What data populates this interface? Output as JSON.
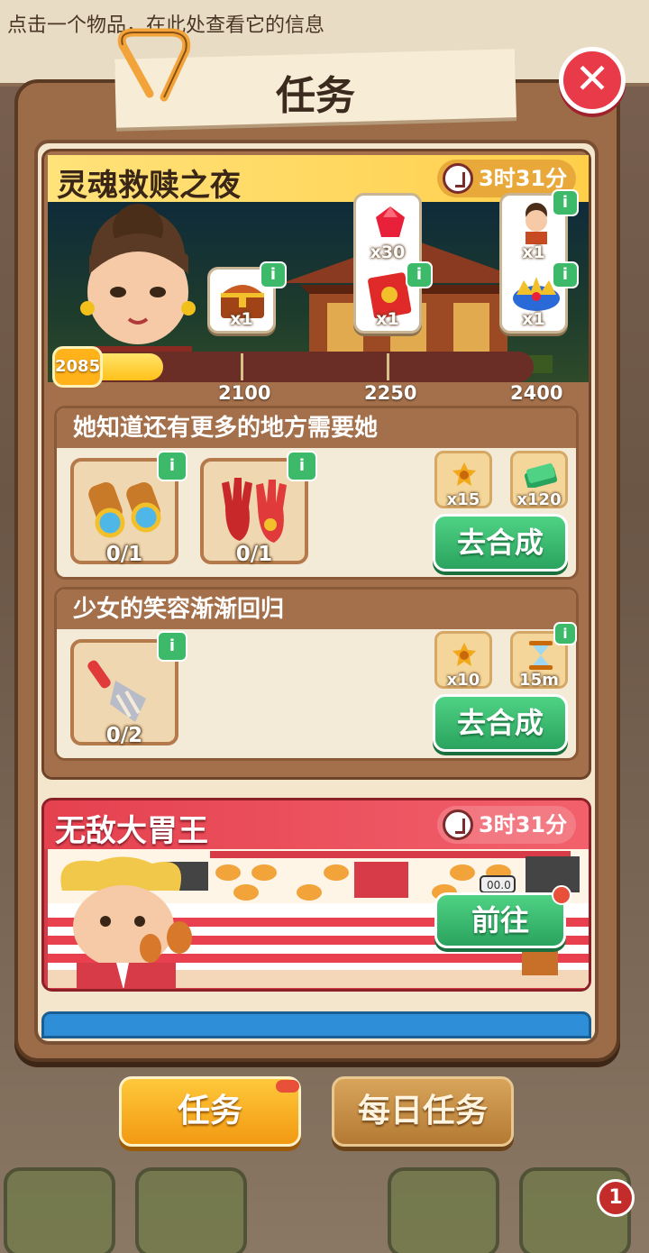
{
  "hint": {
    "text": "点击一个物品，在此处查看它的信息"
  },
  "panel": {
    "title": "任务",
    "close_icon": "close-icon"
  },
  "event1": {
    "title": "灵魂救赎之夜",
    "timer": "3时31分",
    "progress": {
      "current": "2085",
      "current_value": 2085,
      "max_value": 2400,
      "min_value": 2000
    },
    "milestones": [
      {
        "label": "2100",
        "reward_qty": "x1",
        "reward_icon": "treasure-chest-icon"
      },
      {
        "label": "2250",
        "reward_qty_top": "x30",
        "reward_icon_top": "ruby-gem-icon",
        "reward_qty": "x1",
        "reward_icon": "red-envelope-icon"
      },
      {
        "label": "2400",
        "reward_qty_top": "x1",
        "reward_icon_top": "character-portrait-icon",
        "reward_qty": "x1",
        "reward_icon": "jeweled-crown-icon"
      }
    ],
    "info_label": "i",
    "tasks": [
      {
        "title": "她知道还有更多的地方需要她",
        "requirements": [
          {
            "icon": "binoculars-icon",
            "count": "0/1"
          },
          {
            "icon": "red-gloves-icon",
            "count": "0/1"
          }
        ],
        "rewards": [
          {
            "icon": "gold-medal-icon",
            "qty": "x15"
          },
          {
            "icon": "cash-stack-icon",
            "qty": "x120"
          }
        ],
        "button": "去合成"
      },
      {
        "title": "少女的笑容渐渐回归",
        "requirements": [
          {
            "icon": "garden-rake-icon",
            "count": "0/2"
          }
        ],
        "rewards": [
          {
            "icon": "gold-medal-icon",
            "qty": "x10"
          },
          {
            "icon": "hourglass-icon",
            "qty": "15m"
          }
        ],
        "button": "去合成"
      }
    ]
  },
  "event2": {
    "title": "无敌大胃王",
    "timer": "3时31分",
    "button": "前往",
    "counter": "00.0"
  },
  "tabs": {
    "tasks": "任务",
    "daily": "每日任务"
  },
  "bottom": {
    "notification_count": "1"
  },
  "colors": {
    "accent_green": "#3cba6a",
    "event1_header": "#ffd85a",
    "event2_header": "#e5414f",
    "progress_fill": "#ffc11a",
    "tab_active": "#ffb21a"
  }
}
